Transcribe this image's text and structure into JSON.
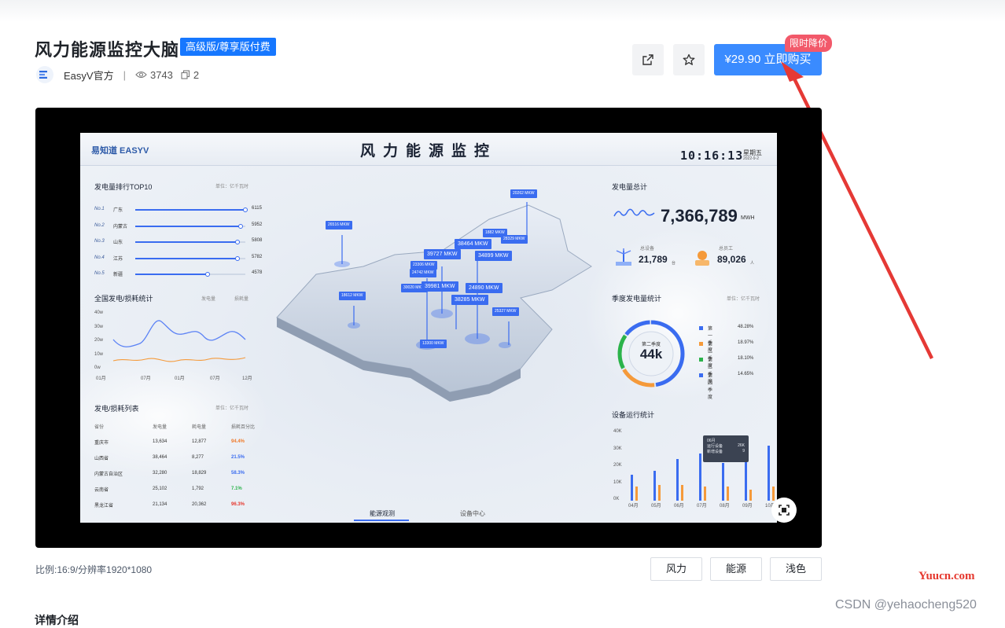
{
  "product": {
    "title": "风力能源监控大脑",
    "badge": "高级版/尊享版付费",
    "author": "EasyV官方",
    "separator": "|",
    "views": "3743",
    "copies": "2"
  },
  "actions": {
    "share_icon": "share-icon",
    "favorite_icon": "star-icon",
    "buy_label": "¥29.90 立即购买",
    "promo_label": "限时降价"
  },
  "screen": {
    "logo": "易知道 EASYV",
    "title": "风力能源监控",
    "time": "10:16:13",
    "weekday": "星期五",
    "date": "2022-9-2",
    "ranking": {
      "title": "发电量排行TOP10",
      "unit": "单位：亿千瓦时",
      "items": [
        {
          "no": "No.1",
          "name": "广东",
          "value": "6115",
          "fraction": 1.0
        },
        {
          "no": "No.2",
          "name": "内蒙古",
          "value": "5952",
          "fraction": 0.96
        },
        {
          "no": "No.3",
          "name": "山东",
          "value": "5808",
          "fraction": 0.93
        },
        {
          "no": "No.4",
          "name": "江苏",
          "value": "5782",
          "fraction": 0.93
        },
        {
          "no": "No.5",
          "name": "新疆",
          "value": "4578",
          "fraction": 0.66
        }
      ]
    },
    "national": {
      "title": "全国发电/损耗统计",
      "legend_gen": "发电量",
      "legend_loss": "损耗量",
      "y_ticks": [
        "40w",
        "30w",
        "20w",
        "10w",
        "0w"
      ],
      "x_ticks": [
        "01月",
        "07月",
        "01月",
        "07月",
        "12月"
      ]
    },
    "table": {
      "title": "发电/损耗列表",
      "unit": "单位：亿千瓦时",
      "headers": [
        "省份",
        "发电量",
        "耗电量",
        "损耗百分比"
      ],
      "rows": [
        {
          "province": "重庆市",
          "gen": "13,634",
          "use": "12,877",
          "pct": "94.4%",
          "color": "#f07a2a"
        },
        {
          "province": "山西省",
          "gen": "38,464",
          "use": "8,277",
          "pct": "21.5%",
          "color": "#3a6cf0"
        },
        {
          "province": "内蒙古自治区",
          "gen": "32,280",
          "use": "18,829",
          "pct": "58.3%",
          "color": "#3a6cf0"
        },
        {
          "province": "云南省",
          "gen": "25,102",
          "use": "1,792",
          "pct": "7.1%",
          "color": "#2bb34a"
        },
        {
          "province": "黑龙江省",
          "gen": "21,134",
          "use": "20,362",
          "pct": "96.3%",
          "color": "#e5382e"
        }
      ]
    },
    "total": {
      "title": "发电量总计",
      "value": "7,366,789",
      "unit": "MWH",
      "devices_label": "总设备",
      "devices_value": "21,789",
      "devices_unit": "台",
      "staff_label": "总员工",
      "staff_value": "89,026",
      "staff_unit": "人"
    },
    "quarter": {
      "title": "季度发电量统计",
      "unit": "单位：亿千瓦时",
      "center_label": "第二季度",
      "center_value": "44k",
      "legend": [
        {
          "name": "第一季度",
          "pct": "48.28%",
          "color": "#3a6cf0"
        },
        {
          "name": "第二季度",
          "pct": "18.97%",
          "color": "#f59a3a"
        },
        {
          "name": "第三季度",
          "pct": "18.10%",
          "color": "#2bb34a"
        },
        {
          "name": "第四季度",
          "pct": "14.65%",
          "color": "#3a6cf0"
        }
      ]
    },
    "devices": {
      "title": "设备运行统计",
      "y_ticks": [
        "40K",
        "30K",
        "20K",
        "10K",
        "0K"
      ],
      "x_ticks": [
        "04月",
        "05月",
        "06月",
        "07月",
        "08月",
        "09月",
        "10月"
      ],
      "tooltip_month": "06月",
      "tooltip_run_label": "运行设备",
      "tooltip_run_value": "26K",
      "tooltip_new_label": "新增设备",
      "tooltip_new_value": "9"
    },
    "map_labels": [
      "26516 MKW",
      "20262 MKW",
      "1882 MKW",
      "38464 MKW",
      "28329 MKW",
      "39727 MKW",
      "34899 MKW",
      "23306 MKW",
      "24742 MKW",
      "30020 MKW",
      "39981 MKW",
      "24890 MKW",
      "38285 MKW",
      "18612 MKW",
      "25327 MKW",
      "13300 MKW"
    ],
    "tabs": [
      "能源观测",
      "设备中心"
    ]
  },
  "footer": {
    "ratio": "比例:16:9/分辨率1920*1080",
    "tags": [
      "风力",
      "能源",
      "浅色"
    ],
    "section": "详情介绍"
  },
  "watermark": {
    "site": "Yuucn.com",
    "csdn": "CSDN @yehaocheng520"
  }
}
